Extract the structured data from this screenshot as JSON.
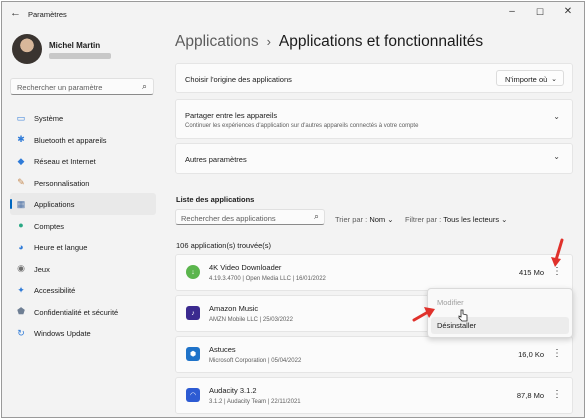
{
  "window": {
    "title": "Paramètres"
  },
  "user": {
    "name": "Michel Martin"
  },
  "search": {
    "placeholder": "Rechercher un paramètre"
  },
  "nav": [
    {
      "label": "Système",
      "icon": "monitor-icon",
      "color": "#2f7bd8"
    },
    {
      "label": "Bluetooth et appareils",
      "icon": "bluetooth-icon",
      "color": "#2f7bd8"
    },
    {
      "label": "Réseau et Internet",
      "icon": "wifi-icon",
      "color": "#2f7bd8"
    },
    {
      "label": "Personnalisation",
      "icon": "brush-icon",
      "color": "#c58a52"
    },
    {
      "label": "Applications",
      "icon": "apps-icon",
      "color": "#4a6fa5",
      "active": true
    },
    {
      "label": "Comptes",
      "icon": "person-icon",
      "color": "#2aa884"
    },
    {
      "label": "Heure et langue",
      "icon": "globe-icon",
      "color": "#2f7bd8"
    },
    {
      "label": "Jeux",
      "icon": "gamepad-icon",
      "color": "#6f6f6f"
    },
    {
      "label": "Accessibilité",
      "icon": "accessibility-icon",
      "color": "#2f7bd8"
    },
    {
      "label": "Confidentialité et sécurité",
      "icon": "shield-icon",
      "color": "#6f7f94"
    },
    {
      "label": "Windows Update",
      "icon": "refresh-icon",
      "color": "#2f7bd8"
    }
  ],
  "breadcrumb": {
    "parent": "Applications",
    "separator": "›",
    "current": "Applications et fonctionnalités"
  },
  "settings": {
    "origin": {
      "title": "Choisir l'origine des applications",
      "value": "N'importe où"
    },
    "share": {
      "title": "Partager entre les appareils",
      "subtitle": "Continuer les expériences d'application sur d'autres appareils connectés à votre compte"
    },
    "more": {
      "title": "Autres paramètres"
    }
  },
  "list": {
    "heading": "Liste des applications",
    "search_placeholder": "Rechercher des applications",
    "sort_label": "Trier par :",
    "sort_value": "Nom",
    "filter_label": "Filtrer par :",
    "filter_value": "Tous les lecteurs",
    "count": "106 application(s) trouvée(s)"
  },
  "apps": [
    {
      "name": "4K Video Downloader",
      "meta": "4.19.3.4700  |  Open Media LLC  |  16/01/2022",
      "size": "415 Mo",
      "icon": "4k-downloader-icon",
      "color": "#5bb54d"
    },
    {
      "name": "Amazon Music",
      "meta": "AMZN Mobile LLC  |  25/03/2022",
      "size": "",
      "icon": "amazon-music-icon",
      "color": "#3b2a8f"
    },
    {
      "name": "Astuces",
      "meta": "Microsoft Corporation  |  05/04/2022",
      "size": "16,0 Ko",
      "icon": "tips-icon",
      "color": "#1f73c9"
    },
    {
      "name": "Audacity 3.1.2",
      "meta": "3.1.2  |  Audacity Team  |  22/11/2021",
      "size": "87,8 Mo",
      "icon": "audacity-icon",
      "color": "#2d5bd3"
    }
  ],
  "context_menu": {
    "items": [
      "Modifier",
      "Désinstaller"
    ]
  },
  "colors": {
    "accent": "#0067c0",
    "annotation_arrow": "#e0312b"
  }
}
